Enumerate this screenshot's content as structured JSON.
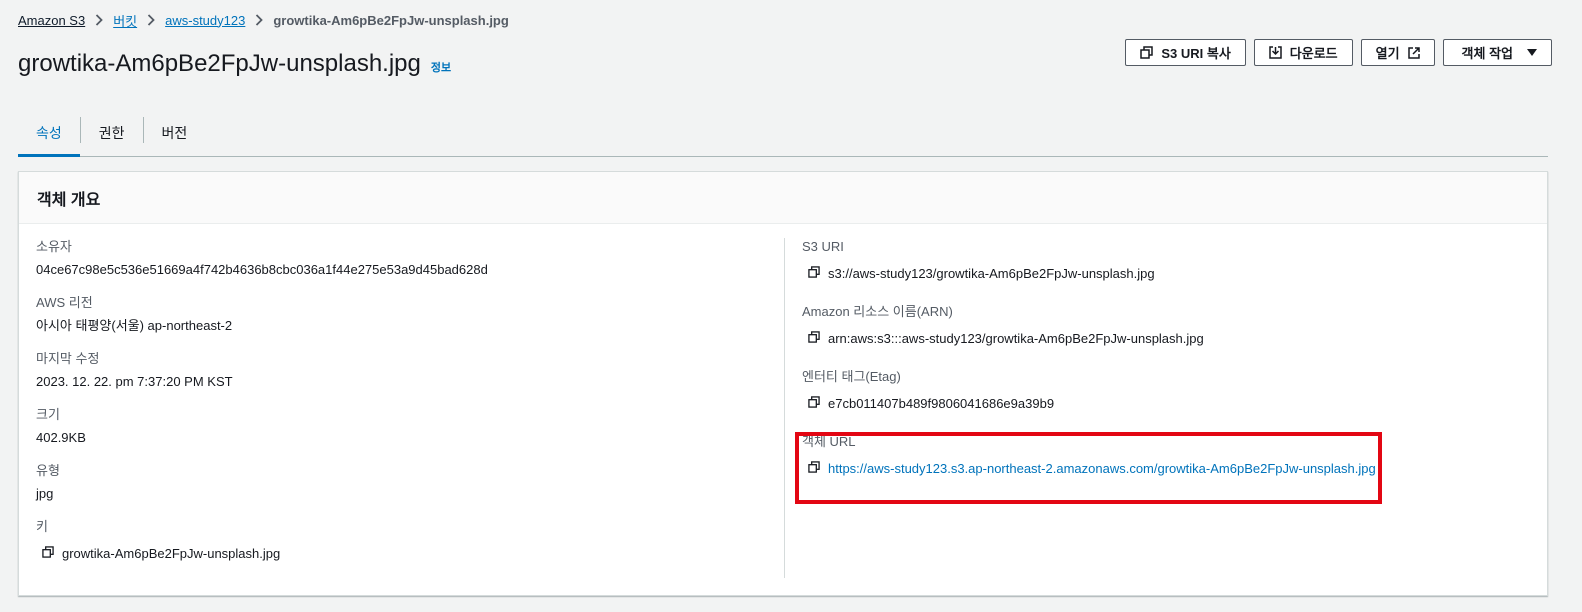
{
  "breadcrumb": {
    "items": [
      "Amazon S3",
      "버킷",
      "aws-study123"
    ],
    "current": "growtika-Am6pBe2FpJw-unsplash.jpg"
  },
  "header": {
    "title": "growtika-Am6pBe2FpJw-unsplash.jpg",
    "info": "정보"
  },
  "actions": {
    "copy_uri": "S3 URI 복사",
    "download": "다운로드",
    "open": "열기",
    "object_actions": "객체 작업"
  },
  "tabs": [
    "속성",
    "권한",
    "버전"
  ],
  "panel": {
    "title": "객체 개요",
    "left": [
      {
        "label": "소유자",
        "value": "04ce67c98e5c536e51669a4f742b4636b8cbc036a1f44e275e53a9d45bad628d"
      },
      {
        "label": "AWS 리전",
        "value": "아시아 태평양(서울) ap-northeast-2"
      },
      {
        "label": "마지막 수정",
        "value": "2023. 12. 22. pm 7:37:20 PM KST"
      },
      {
        "label": "크기",
        "value": "402.9KB"
      },
      {
        "label": "유형",
        "value": "jpg"
      },
      {
        "label": "키",
        "value": "growtika-Am6pBe2FpJw-unsplash.jpg"
      }
    ],
    "right": [
      {
        "label": "S3 URI",
        "value": "s3://aws-study123/growtika-Am6pBe2FpJw-unsplash.jpg"
      },
      {
        "label": "Amazon 리소스 이름(ARN)",
        "value": "arn:aws:s3:::aws-study123/growtika-Am6pBe2FpJw-unsplash.jpg"
      },
      {
        "label": "엔터티 태그(Etag)",
        "value": "e7cb011407b489f9806041686e9a39b9"
      },
      {
        "label": "객체 URL",
        "value": "https://aws-study123.s3.ap-northeast-2.amazonaws.com/growtika-Am6pBe2FpJw-unsplash.jpg"
      }
    ]
  },
  "colors": {
    "accent": "#0073bb",
    "highlight": "#e30613"
  },
  "icons": [
    "copy-icon",
    "download-icon",
    "external-link-icon",
    "caret-down-icon",
    "chevron-right-icon"
  ]
}
